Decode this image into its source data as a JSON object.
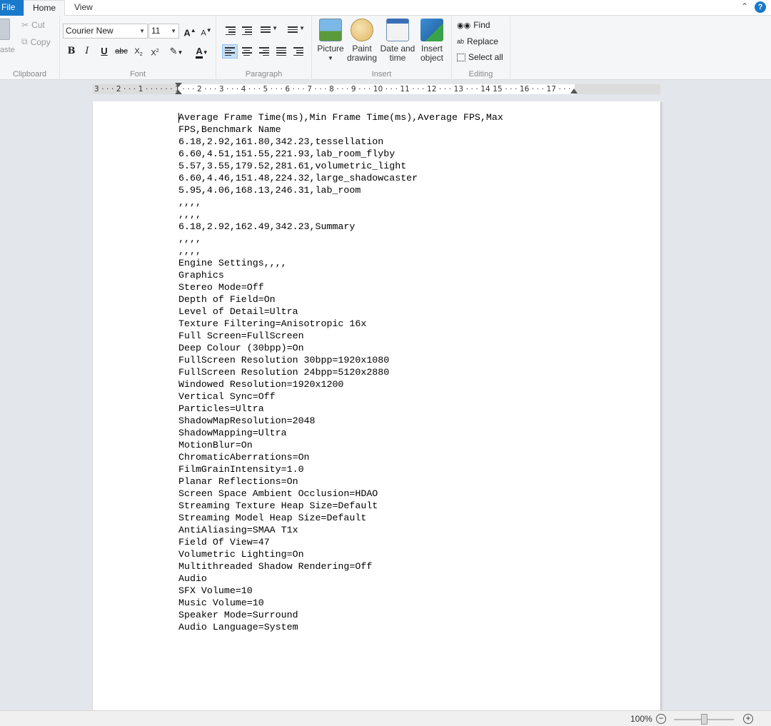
{
  "tabs": {
    "file": "File",
    "home": "Home",
    "view": "View"
  },
  "clipboard": {
    "paste_label": "aste",
    "cut": "Cut",
    "copy": "Copy",
    "group_label": "Clipboard"
  },
  "font": {
    "family": "Courier New",
    "size": "11",
    "group_label": "Font"
  },
  "paragraph": {
    "group_label": "Paragraph"
  },
  "insert": {
    "picture": "Picture",
    "paint_line1": "Paint",
    "paint_line2": "drawing",
    "datetime_line1": "Date and",
    "datetime_line2": "time",
    "object_line1": "Insert",
    "object_line2": "object",
    "group_label": "Insert"
  },
  "editing": {
    "find": "Find",
    "replace": "Replace",
    "select_all": "Select all",
    "group_label": "Editing"
  },
  "ruler": {
    "text": "3 · · · 2 · · · 1 · · ·   · · · 1 · · · 2 · · · 3 · · · 4 · · · 5 · · · 6 · · · 7 · · · 8 · · · 9 · · · 10 · · · 11 · · · 12 · · · 13 · · · 14  15 · · · 16 · · · 17 · · ·"
  },
  "document": {
    "lines": [
      "Average Frame Time(ms),Min Frame Time(ms),Average FPS,Max",
      "FPS,Benchmark Name",
      "6.18,2.92,161.80,342.23,tessellation",
      "6.60,4.51,151.55,221.93,lab_room_flyby",
      "5.57,3.55,179.52,281.61,volumetric_light",
      "6.60,4.46,151.48,224.32,large_shadowcaster",
      "5.95,4.06,168.13,246.31,lab_room",
      ",,,,",
      ",,,,",
      "6.18,2.92,162.49,342.23,Summary",
      ",,,,",
      ",,,,",
      "Engine Settings,,,,",
      "Graphics",
      "Stereo Mode=Off",
      "Depth of Field=On",
      "Level of Detail=Ultra",
      "Texture Filtering=Anisotropic 16x",
      "Full Screen=FullScreen",
      "Deep Colour (30bpp)=On",
      "FullScreen Resolution 30bpp=1920x1080",
      "FullScreen Resolution 24bpp=5120x2880",
      "Windowed Resolution=1920x1200",
      "Vertical Sync=Off",
      "Particles=Ultra",
      "ShadowMapResolution=2048",
      "ShadowMapping=Ultra",
      "MotionBlur=On",
      "ChromaticAberrations=On",
      "FilmGrainIntensity=1.0",
      "Planar Reflections=On",
      "Screen Space Ambient Occlusion=HDAO",
      "Streaming Texture Heap Size=Default",
      "Streaming Model Heap Size=Default",
      "AntiAliasing=SMAA T1x",
      "Field Of View=47",
      "Volumetric Lighting=On",
      "Multithreaded Shadow Rendering=Off",
      "Audio",
      "SFX Volume=10",
      "Music Volume=10",
      "Speaker Mode=Surround",
      "Audio Language=System"
    ]
  },
  "status": {
    "zoom": "100%",
    "zoom_minus": "−",
    "zoom_plus": "+"
  }
}
